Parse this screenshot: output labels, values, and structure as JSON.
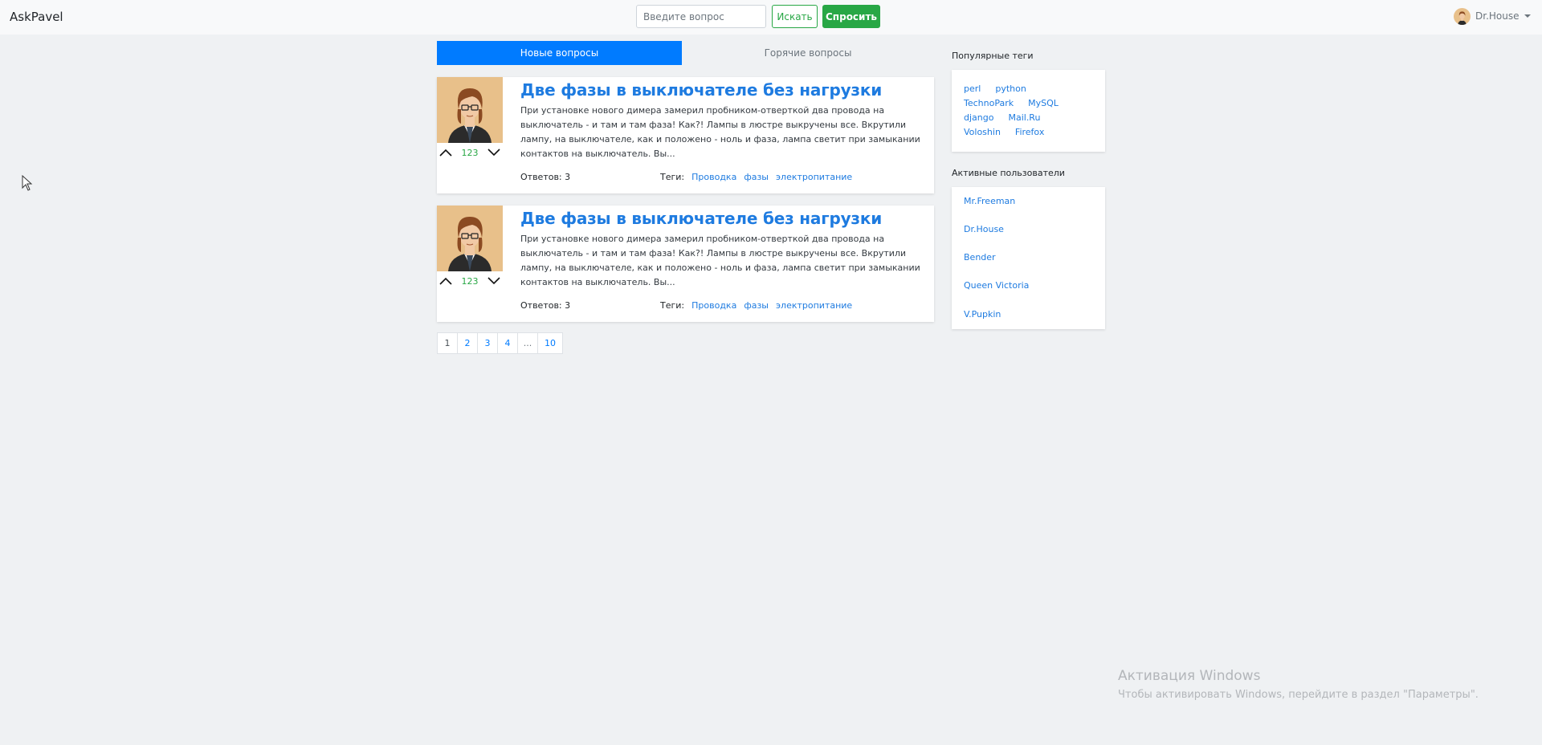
{
  "navbar": {
    "brand": "AskPavel",
    "search_placeholder": "Введите вопрос",
    "search_button": "Искать",
    "ask_button": "Спросить",
    "user_name": "Dr.House"
  },
  "tabs": [
    {
      "label": "Новые вопросы",
      "active": true
    },
    {
      "label": "Горячие вопросы",
      "active": false
    }
  ],
  "questions": [
    {
      "title": "Две фазы в выключателе без нагрузки",
      "text": "При установке нового димера замерил пробником-отверткой два провода на выключатель - и там и там фаза! Как?! Лампы в люстре выкручены все. Вкрутили лампу, на выключателе, как и положено - ноль и фаза, лампа светит при замыкании контактов на выключатель. Вы...",
      "votes": "123",
      "answers": "Ответов: 3",
      "tags_label": "Теги:",
      "tags": [
        "Проводка",
        "фазы",
        "электропитание"
      ]
    },
    {
      "title": "Две фазы в выключателе без нагрузки",
      "text": "При установке нового димера замерил пробником-отверткой два провода на выключатель - и там и там фаза! Как?! Лампы в люстре выкручены все. Вкрутили лампу, на выключателе, как и положено - ноль и фаза, лампа светит при замыкании контактов на выключатель. Вы...",
      "votes": "123",
      "answers": "Ответов: 3",
      "tags_label": "Теги:",
      "tags": [
        "Проводка",
        "фазы",
        "электропитание"
      ]
    }
  ],
  "pagination": [
    "1",
    "2",
    "3",
    "4",
    "...",
    "10"
  ],
  "sidebar": {
    "popular_tags_title": "Популярные теги",
    "popular_tags": [
      [
        "perl",
        "python"
      ],
      [
        "TechnoPark",
        "MySQL"
      ],
      [
        "django",
        "Mail.Ru"
      ],
      [
        "Voloshin",
        "Firefox"
      ]
    ],
    "active_users_title": "Активные пользователи",
    "active_users": [
      "Mr.Freeman",
      "Dr.House",
      "Bender",
      "Queen Victoria",
      "V.Pupkin"
    ]
  },
  "watermark": {
    "title": "Активация Windows",
    "subtitle": "Чтобы активировать Windows, перейдите в раздел \"Параметры\"."
  },
  "colors": {
    "primary": "#007bff",
    "link": "#1e7be0",
    "success": "#28a745",
    "avatar_bg": "#e8c08a"
  }
}
